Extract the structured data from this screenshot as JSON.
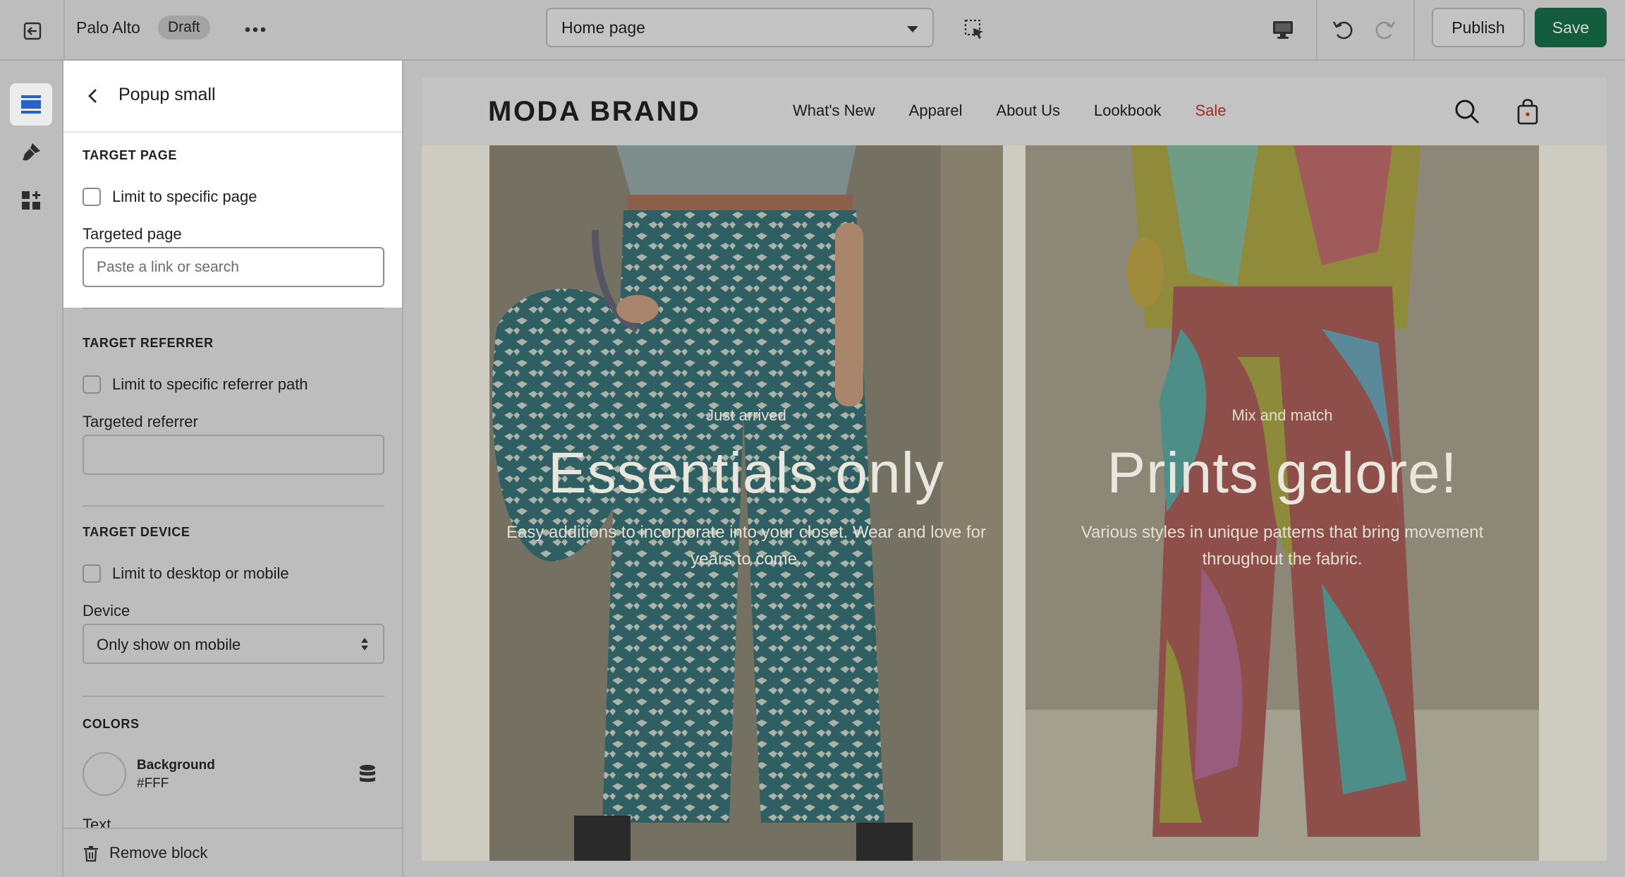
{
  "topbar": {
    "store_name": "Palo Alto",
    "status_badge": "Draft",
    "page_select": "Home page",
    "publish_label": "Publish",
    "save_label": "Save"
  },
  "panel": {
    "title": "Popup small",
    "target_page": {
      "heading": "TARGET PAGE",
      "checkbox_label": "Limit to specific page",
      "field_label": "Targeted page",
      "input_placeholder": "Paste a link or search",
      "input_value": ""
    },
    "target_referrer": {
      "heading": "TARGET REFERRER",
      "checkbox_label": "Limit to specific referrer path",
      "field_label": "Targeted referrer",
      "input_value": ""
    },
    "target_device": {
      "heading": "TARGET DEVICE",
      "checkbox_label": "Limit to desktop or mobile",
      "field_label": "Device",
      "select_value": "Only show on mobile"
    },
    "colors": {
      "heading": "COLORS",
      "background_label": "Background",
      "background_value": "#FFF",
      "next_label_peek": "Text"
    },
    "remove_label": "Remove block"
  },
  "preview": {
    "brand": "MODA BRAND",
    "nav": [
      "What's New",
      "Apparel",
      "About Us",
      "Lookbook",
      "Sale"
    ],
    "cards": [
      {
        "eyebrow": "Just arrived",
        "headline": "Essentials only",
        "description": "Easy additions to incorporate into your closet. Wear and love for years to come."
      },
      {
        "eyebrow": "Mix and match",
        "headline": "Prints galore!",
        "description": "Various styles in unique patterns that bring movement throughout the fabric."
      }
    ]
  },
  "colors": {
    "overlay_gray": "#bdbdbd",
    "save_green": "#135c3d",
    "sale_red": "#a32b22",
    "active_panel_white": "#ffffff"
  },
  "icons": [
    "exit-icon",
    "more-icon",
    "inspector-icon",
    "desktop-icon",
    "undo-icon",
    "redo-icon",
    "sections-icon",
    "theme-settings-icon",
    "app-blocks-icon",
    "back-chevron-icon",
    "database-icon",
    "trash-icon",
    "search-icon",
    "cart-icon"
  ]
}
